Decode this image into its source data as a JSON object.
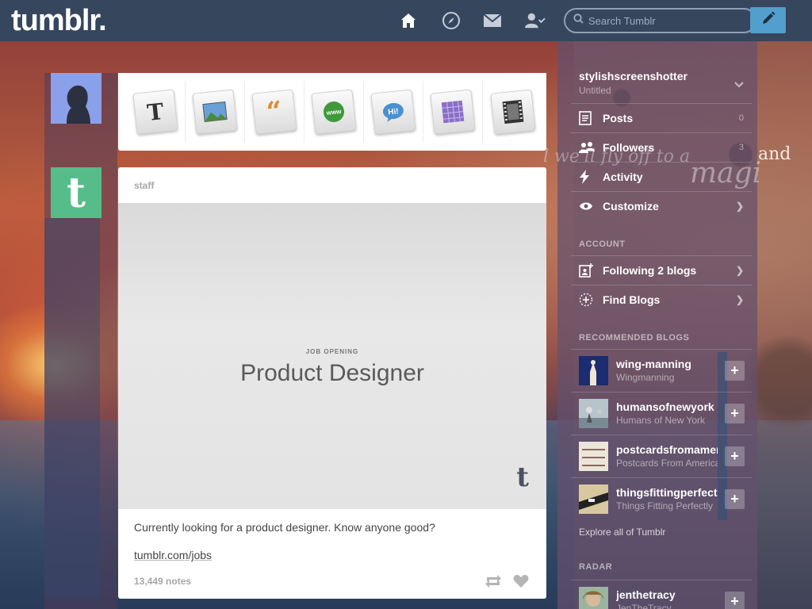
{
  "header": {
    "logo": "tumblr.",
    "search_placeholder": "Search Tumblr",
    "nav_icons": [
      "home-icon",
      "compass-icon",
      "mail-icon",
      "account-icon"
    ],
    "compose_icon": "pencil-icon",
    "bar_color": "#36465d",
    "compose_color": "#529ecc"
  },
  "post_types": [
    "text",
    "photo",
    "quote",
    "link",
    "chat",
    "audio",
    "video"
  ],
  "post": {
    "author": "staff",
    "kicker": "JOB OPENING",
    "title": "Product Designer",
    "body": "Currently looking for a product designer. Know anyone good?",
    "link": "tumblr.com/jobs",
    "notes": "13,449 notes",
    "avatar_color": "#56bc8a"
  },
  "sidebar": {
    "blog_name": "stylishscreenshotter",
    "blog_title": "Untitled",
    "items": [
      {
        "label": "Posts",
        "count": "0"
      },
      {
        "label": "Followers",
        "count": "3"
      },
      {
        "label": "Activity"
      },
      {
        "label": "Customize"
      }
    ],
    "account_heading": "ACCOUNT",
    "account_items": [
      {
        "label": "Following 2 blogs"
      },
      {
        "label": "Find Blogs"
      }
    ],
    "recommended_heading": "RECOMMENDED BLOGS",
    "recommended": [
      {
        "name": "wing-manning",
        "title": "Wingmanning"
      },
      {
        "name": "humansofnewyork",
        "title": "Humans of New York"
      },
      {
        "name": "postcardsfromamerica",
        "title": "Postcards From America"
      },
      {
        "name": "thingsfittingperfectly",
        "title": "Things Fitting Perfectly"
      }
    ],
    "explore": "Explore all of Tumblr",
    "radar_heading": "RADAR",
    "radar": [
      {
        "name": "jenthetracy",
        "title": "JenTheTracy"
      }
    ]
  }
}
